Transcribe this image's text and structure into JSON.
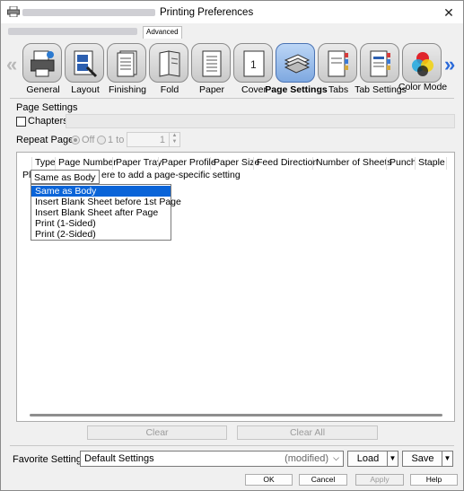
{
  "window": {
    "title": "Printing Preferences",
    "close_glyph": "✕",
    "tab_label": "Advanced"
  },
  "nav": {
    "left_glyph": "«",
    "right_glyph": "»"
  },
  "features": [
    {
      "label": "General",
      "icon": "general-icon"
    },
    {
      "label": "Layout",
      "icon": "layout-icon"
    },
    {
      "label": "Finishing",
      "icon": "finishing-icon"
    },
    {
      "label": "Fold",
      "icon": "fold-icon"
    },
    {
      "label": "Paper",
      "icon": "paper-icon"
    },
    {
      "label": "Cover",
      "icon": "cover-icon"
    },
    {
      "label": "Page Settings",
      "icon": "page-settings-icon",
      "active": true
    },
    {
      "label": "Tabs",
      "icon": "tabs-icon"
    },
    {
      "label": "Tab Settings",
      "icon": "tab-settings-icon"
    },
    {
      "label": "Color Mode",
      "icon": "color-mode-icon"
    }
  ],
  "page_settings": {
    "section_title": "Page Settings",
    "chapters_label": "Chapters",
    "chapters_checked": false,
    "repeat_label": "Repeat Pages",
    "repeat_off": "Off",
    "repeat_1to": "1 to",
    "repeat_value": "1"
  },
  "grid": {
    "columns": [
      "Type",
      "Page Number",
      "Paper Tray",
      "Paper Profile",
      "Paper Size",
      "Feed Direction",
      "Number of Sheets",
      "Punch",
      "Staple"
    ],
    "row_prefix": "Pl",
    "row_hint": "ere to add a page-specific setting"
  },
  "type_combo": {
    "value": "Same as Body",
    "chevron": "⌵",
    "options": [
      "Same as Body",
      "Insert Blank Sheet before 1st Page",
      "Insert Blank Sheet after Page",
      "Print (1-Sided)",
      "Print (2-Sided)"
    ],
    "selected_index": 0
  },
  "buttons": {
    "clear": "Clear",
    "clear_all": "Clear All"
  },
  "favorite": {
    "label": "Favorite Setting",
    "value": "Default Settings",
    "status": "(modified)",
    "chevron": "⌵",
    "load": "Load",
    "save": "Save",
    "split_arrow": "▼"
  },
  "dialog": {
    "ok": "OK",
    "cancel": "Cancel",
    "apply": "Apply",
    "help": "Help"
  },
  "colors": {
    "accent": "#0a64d8",
    "nav_arrow": "#2b6ad9",
    "active_tab": "#7ea8e0"
  }
}
